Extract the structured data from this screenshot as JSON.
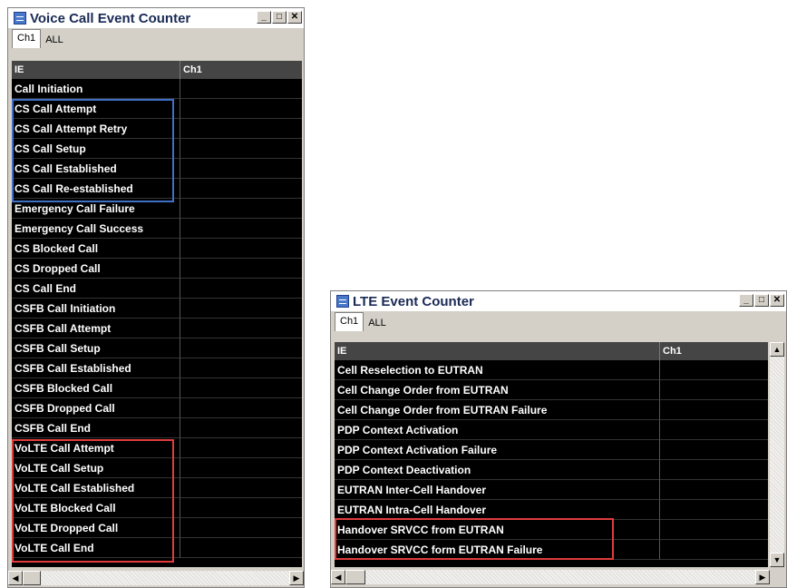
{
  "voice_window": {
    "title": "Voice Call Event Counter",
    "tabs": [
      {
        "label": "Ch1",
        "active": true
      },
      {
        "label": "ALL",
        "active": false
      }
    ],
    "columns": [
      "IE",
      "Ch1"
    ],
    "rows": [
      {
        "ie": "Call Initiation",
        "ch1": ""
      },
      {
        "ie": "CS Call Attempt",
        "ch1": ""
      },
      {
        "ie": "CS Call Attempt Retry",
        "ch1": ""
      },
      {
        "ie": "CS Call Setup",
        "ch1": ""
      },
      {
        "ie": "CS Call Established",
        "ch1": ""
      },
      {
        "ie": "CS Call Re-established",
        "ch1": ""
      },
      {
        "ie": "Emergency Call Failure",
        "ch1": ""
      },
      {
        "ie": "Emergency Call Success",
        "ch1": ""
      },
      {
        "ie": "CS Blocked Call",
        "ch1": ""
      },
      {
        "ie": "CS Dropped Call",
        "ch1": ""
      },
      {
        "ie": "CS Call End",
        "ch1": ""
      },
      {
        "ie": "CSFB Call Initiation",
        "ch1": ""
      },
      {
        "ie": "CSFB Call Attempt",
        "ch1": ""
      },
      {
        "ie": "CSFB Call Setup",
        "ch1": ""
      },
      {
        "ie": "CSFB Call Established",
        "ch1": ""
      },
      {
        "ie": "CSFB Blocked Call",
        "ch1": ""
      },
      {
        "ie": "CSFB Dropped Call",
        "ch1": ""
      },
      {
        "ie": "CSFB Call End",
        "ch1": ""
      },
      {
        "ie": "VoLTE Call Attempt",
        "ch1": ""
      },
      {
        "ie": "VoLTE Call Setup",
        "ch1": ""
      },
      {
        "ie": "VoLTE Call Established",
        "ch1": ""
      },
      {
        "ie": "VoLTE Blocked Call",
        "ch1": ""
      },
      {
        "ie": "VoLTE Dropped Call",
        "ch1": ""
      },
      {
        "ie": "VoLTE Call End",
        "ch1": ""
      }
    ]
  },
  "lte_window": {
    "title": "LTE Event Counter",
    "tabs": [
      {
        "label": "Ch1",
        "active": true
      },
      {
        "label": "ALL",
        "active": false
      }
    ],
    "columns": [
      "IE",
      "Ch1"
    ],
    "rows": [
      {
        "ie": "Cell Reselection to EUTRAN",
        "ch1": ""
      },
      {
        "ie": "Cell Change Order from EUTRAN",
        "ch1": ""
      },
      {
        "ie": "Cell Change Order from EUTRAN Failure",
        "ch1": ""
      },
      {
        "ie": "PDP Context Activation",
        "ch1": ""
      },
      {
        "ie": "PDP Context Activation Failure",
        "ch1": ""
      },
      {
        "ie": "PDP Context Deactivation",
        "ch1": ""
      },
      {
        "ie": "EUTRAN Inter-Cell Handover",
        "ch1": ""
      },
      {
        "ie": "EUTRAN Intra-Cell Handover",
        "ch1": ""
      },
      {
        "ie": "Handover SRVCC from EUTRAN",
        "ch1": ""
      },
      {
        "ie": "Handover SRVCC form EUTRAN Failure",
        "ch1": ""
      }
    ]
  },
  "window_buttons": {
    "minimize": "_",
    "maximize": "□",
    "close": "✕"
  },
  "scroll_glyphs": {
    "left": "◀",
    "right": "▶",
    "up": "▲",
    "down": "▼"
  },
  "highlight_colors": {
    "blue": "#3f6fc8",
    "red": "#e03c3c"
  }
}
